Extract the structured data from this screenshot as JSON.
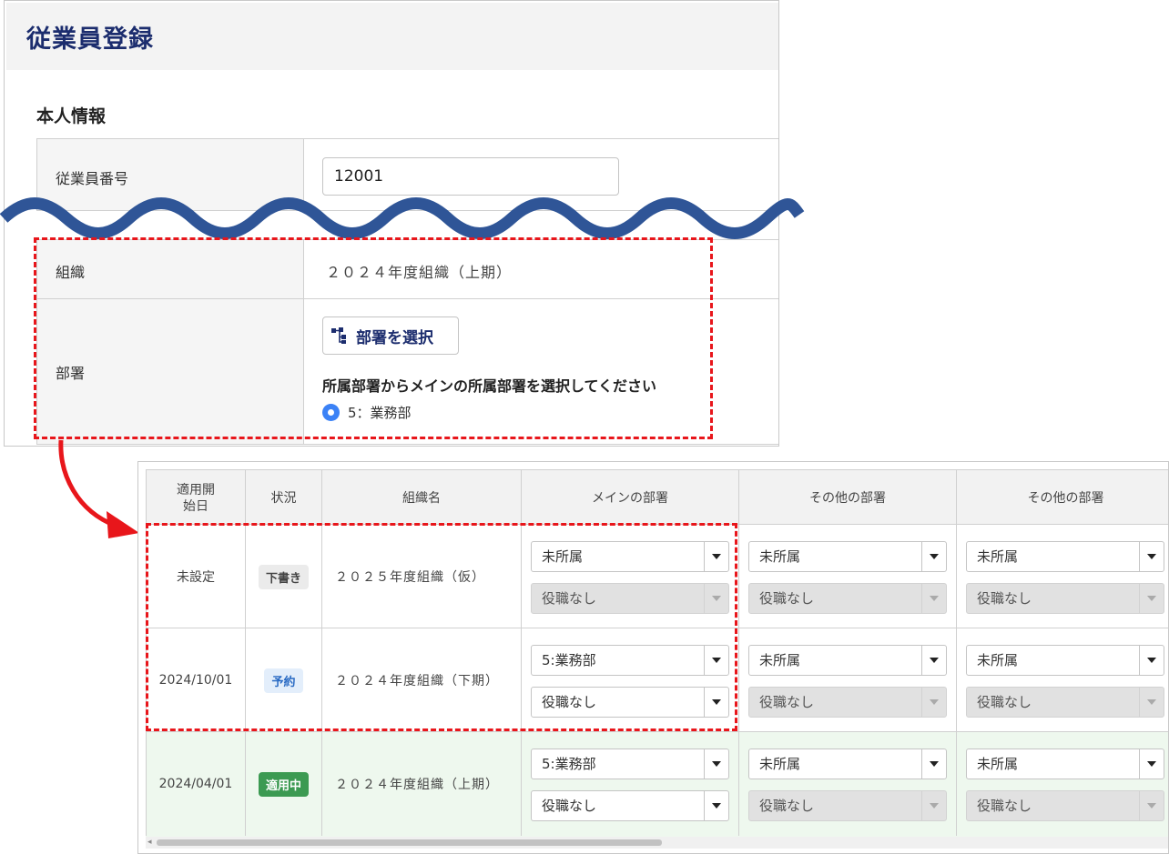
{
  "page": {
    "title": "従業員登録"
  },
  "personal": {
    "section_title": "本人情報",
    "employee_number_label": "従業員番号",
    "employee_number_value": "12001",
    "org_label": "組織",
    "org_value": "２０２４年度組織（上期）",
    "dept_label": "部署",
    "dept_button_label": "部署を選択",
    "dept_hint": "所属部署からメインの所属部署を選択してください",
    "dept_radio_label": "5：業務部"
  },
  "history": {
    "headers": {
      "start_date": "適用開始日",
      "status": "状況",
      "org_name": "組織名",
      "main_dept": "メインの部署",
      "other_dept_1": "その他の部署",
      "other_dept_2": "その他の部署"
    },
    "rows": [
      {
        "start_date": "未設定",
        "status": "下書き",
        "org_name": "２０２５年度組織（仮）",
        "main_dept": "未所属",
        "main_role": "役職なし",
        "other1_dept": "未所属",
        "other1_role": "役職なし",
        "other2_dept": "未所属",
        "other2_role": "役職なし"
      },
      {
        "start_date": "2024/10/01",
        "status": "予約",
        "org_name": "２０２４年度組織（下期）",
        "main_dept": "5:業務部",
        "main_role": "役職なし",
        "other1_dept": "未所属",
        "other1_role": "役職なし",
        "other2_dept": "未所属",
        "other2_role": "役職なし"
      },
      {
        "start_date": "2024/04/01",
        "status": "適用中",
        "org_name": "２０２４年度組織（上期）",
        "main_dept": "5:業務部",
        "main_role": "役職なし",
        "other1_dept": "未所属",
        "other1_role": "役職なし",
        "other2_dept": "未所属",
        "other2_role": "役職なし"
      }
    ]
  },
  "colors": {
    "title": "#1c2d6e",
    "highlight_dash": "#e8161b",
    "wave": "#2f5597",
    "active_row_bg": "#eef8ee",
    "badge_active": "#3c9a52",
    "badge_reserved_text": "#2a6bc4",
    "radio": "#3b82f6"
  },
  "icons": {
    "dept_button": "org-tree-icon",
    "radio": "radio-selected-icon"
  }
}
